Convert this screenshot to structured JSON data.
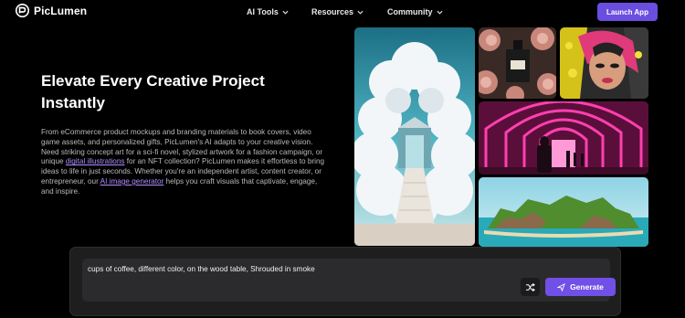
{
  "header": {
    "brand": "PicLumen",
    "nav": [
      {
        "label": "AI Tools"
      },
      {
        "label": "Resources"
      },
      {
        "label": "Community"
      }
    ],
    "launch_label": "Launch App",
    "accent_color": "#6a4ee0"
  },
  "hero": {
    "title": "Elevate Every Creative Project Instantly",
    "desc_part1": "From eCommerce product mockups and branding materials to book covers, video game assets, and personalized gifts, PicLumen's AI adapts to your creative vision. Need striking concept art for a sci-fi novel, stylized artwork for a fashion campaign, or unique ",
    "desc_link1": "digital illustrations",
    "desc_part2": " for an NFT collection? PicLumen makes it effortless to bring ideas to life in just seconds. Whether you're an independent artist, content creator, or entrepreneur, our ",
    "desc_link2": "AI image generator",
    "desc_part3": " helps you craft visuals that captivate, engage, and inspire."
  },
  "prompt": {
    "value": "cups of coffee, different color, on the wood table, Shrouded in smoke",
    "generate_label": "Generate",
    "shuffle_icon": "shuffle-icon",
    "send_icon": "send-icon"
  }
}
